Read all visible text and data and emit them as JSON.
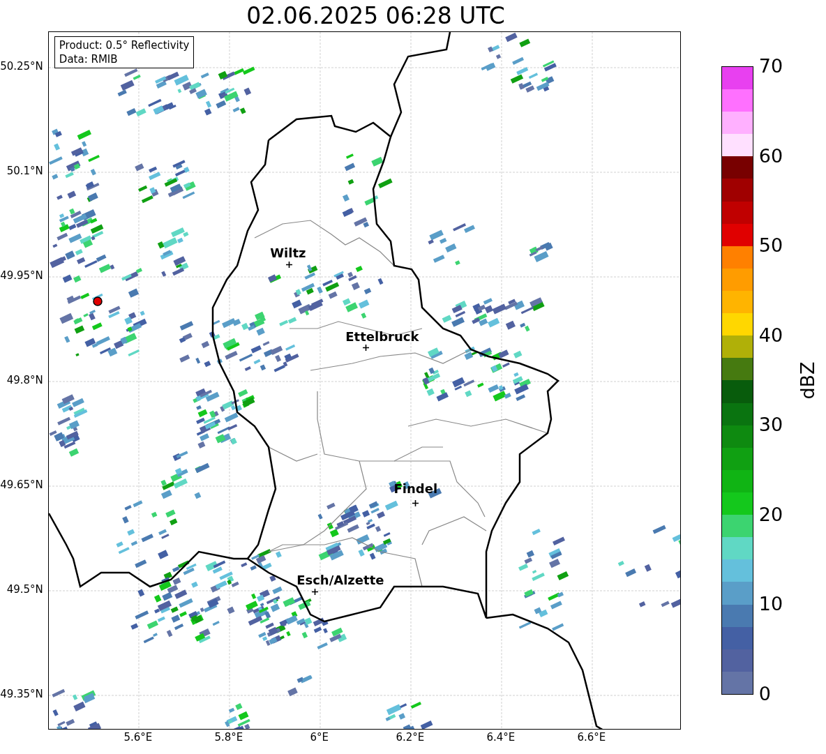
{
  "title": "02.06.2025 06:28 UTC",
  "info_box": {
    "lines": [
      "Product: 0.5° Reflectivity",
      "Data: RMIB"
    ]
  },
  "map": {
    "cities": [
      {
        "name": "Wiltz"
      },
      {
        "name": "Ettelbruck"
      },
      {
        "name": "Findel"
      },
      {
        "name": "Esch/Alzette"
      }
    ],
    "y_ticks": [
      "50.25°N",
      "50.1°N",
      "49.95°N",
      "49.8°N",
      "49.65°N",
      "49.5°N",
      "49.35°N"
    ],
    "x_ticks": [
      "5.6°E",
      "5.8°E",
      "6°E",
      "6.2°E",
      "6.4°E",
      "6.6°E"
    ]
  },
  "colorbar": {
    "label": "dBZ",
    "ticks": [
      "70",
      "60",
      "50",
      "40",
      "30",
      "20",
      "10",
      "0"
    ],
    "steps": [
      {
        "color": "#6474a6"
      },
      {
        "color": "#5262a0"
      },
      {
        "color": "#4460a4"
      },
      {
        "color": "#4a7ab0"
      },
      {
        "color": "#5a9ec8"
      },
      {
        "color": "#64c0dc"
      },
      {
        "color": "#60d8c4"
      },
      {
        "color": "#3cd470"
      },
      {
        "color": "#14c81c"
      },
      {
        "color": "#10b414"
      },
      {
        "color": "#10a012"
      },
      {
        "color": "#0e8a10"
      },
      {
        "color": "#0a7410"
      },
      {
        "color": "#085c0c"
      },
      {
        "color": "#467a10"
      },
      {
        "color": "#b0b008"
      },
      {
        "color": "#ffd700"
      },
      {
        "color": "#ffb400"
      },
      {
        "color": "#ff9c00"
      },
      {
        "color": "#ff8000"
      },
      {
        "color": "#e00000"
      },
      {
        "color": "#c00000"
      },
      {
        "color": "#a00000"
      },
      {
        "color": "#780000"
      },
      {
        "color": "#ffe0ff"
      },
      {
        "color": "#ffb0ff"
      },
      {
        "color": "#ff70ff"
      },
      {
        "color": "#e840f0"
      }
    ]
  }
}
